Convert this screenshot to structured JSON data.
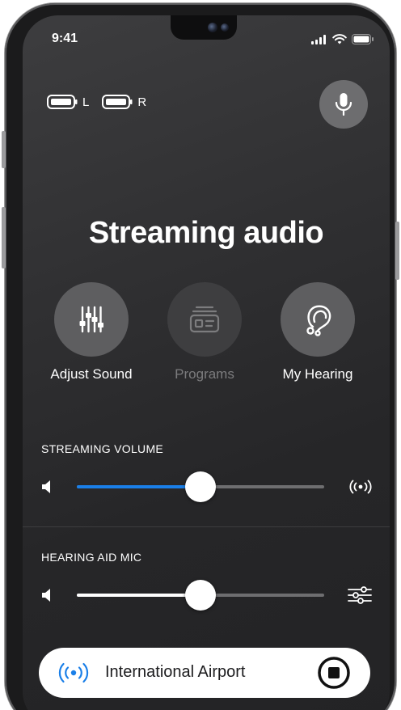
{
  "status_bar": {
    "time": "9:41"
  },
  "hearing_aids": {
    "left_label": "L",
    "right_label": "R"
  },
  "page_title": "Streaming audio",
  "actions": [
    {
      "label": "Adjust Sound",
      "icon": "sliders-icon",
      "enabled": true
    },
    {
      "label": "Programs",
      "icon": "programs-icon",
      "enabled": false
    },
    {
      "label": "My Hearing",
      "icon": "ear-icon",
      "enabled": true
    }
  ],
  "streaming_volume": {
    "label": "STREAMING VOLUME",
    "level": 0.5,
    "accent_color": "#1a7fe8"
  },
  "hearing_aid_mic": {
    "label": "HEARING AID MIC",
    "level": 0.5,
    "default_mark": 0.5
  },
  "now_playing": {
    "source": "International Airport",
    "accent_color": "#1a7fe8"
  },
  "colors": {
    "background": "#2b2b2d",
    "button": "#5e5e60"
  }
}
